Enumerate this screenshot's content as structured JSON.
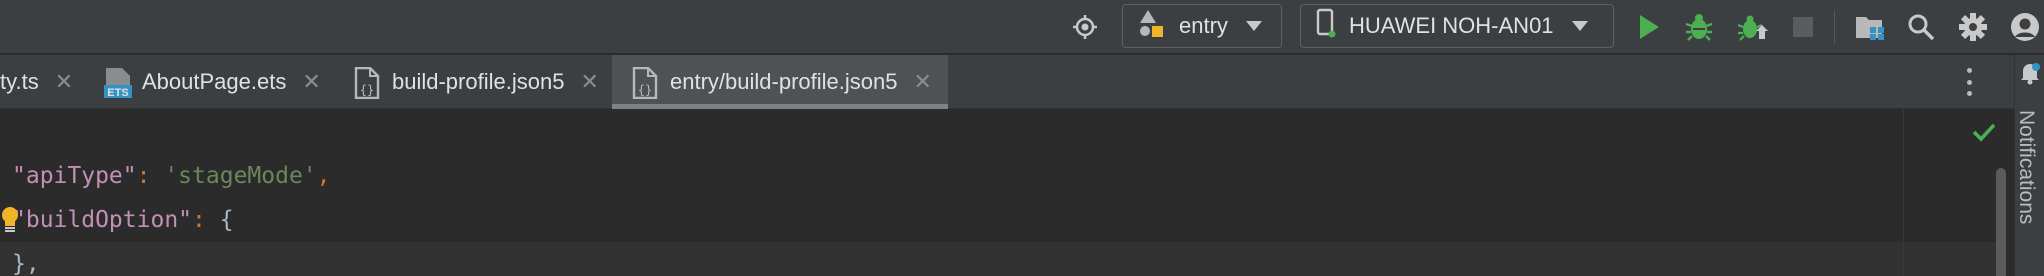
{
  "toolbar": {
    "module_combo": {
      "label": "entry",
      "icon": "module-shapes-icon"
    },
    "device_combo": {
      "label": "HUAWEI NOH-AN01",
      "icon": "phone-icon"
    },
    "icons": [
      "locate-icon",
      "run-icon",
      "debug-icon",
      "attach-debugger-icon",
      "stop-icon",
      "project-structure-icon",
      "search-icon",
      "settings-icon",
      "account-icon"
    ]
  },
  "tabs": [
    {
      "label": "ty.ts",
      "icon": "ts-file-icon",
      "active": false
    },
    {
      "label": "AboutPage.ets",
      "icon": "ets-file-icon",
      "badge": "ETS",
      "active": false
    },
    {
      "label": "build-profile.json5",
      "icon": "json-file-icon",
      "active": false
    },
    {
      "label": "entry/build-profile.json5",
      "icon": "json-file-icon",
      "active": true
    }
  ],
  "side_panel": {
    "label": "Notifications"
  },
  "code": {
    "line1": {
      "key": "\"apiType\"",
      "colon": ": ",
      "value": "'stageMode'",
      "comma": ","
    },
    "line2": {
      "key": "\"buildOption\"",
      "colon": ": ",
      "brace": "{"
    },
    "line3": {
      "text": "},"
    }
  },
  "colors": {
    "run": "#4caf50",
    "debug": "#4caf50",
    "check": "#4caf50",
    "bulb": "#f0b429",
    "active_tab": "#4e5254"
  }
}
